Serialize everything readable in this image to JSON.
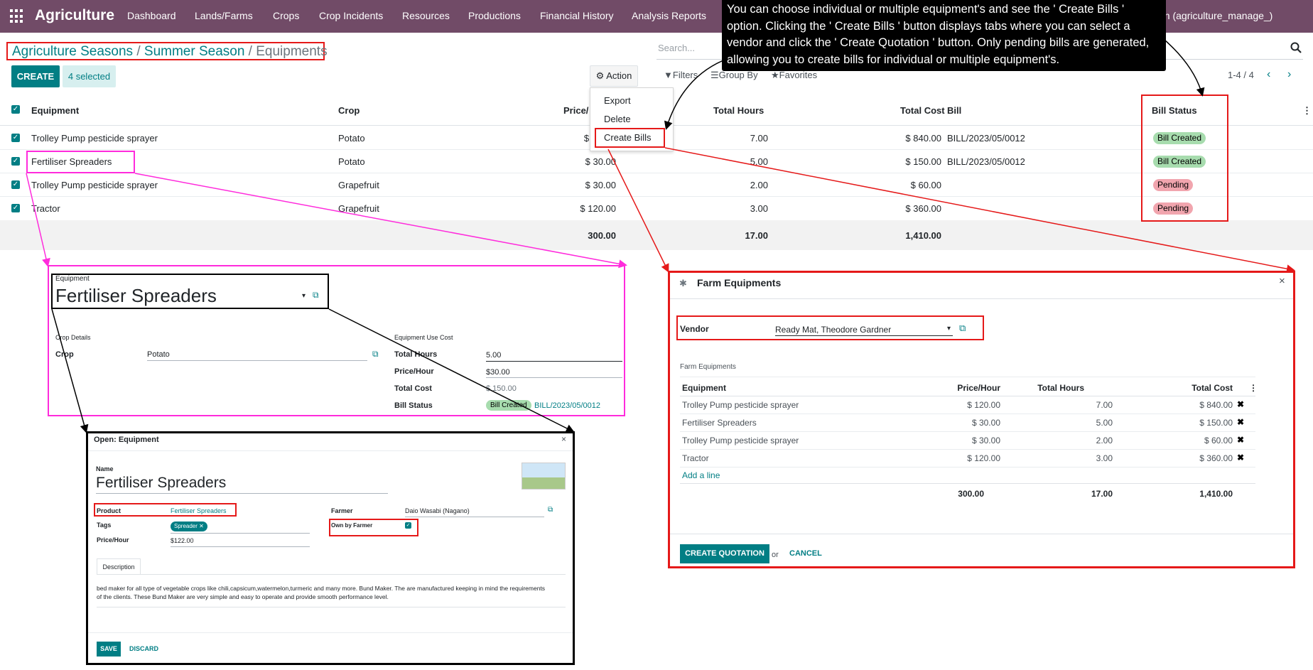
{
  "navbar": {
    "brand": "Agriculture",
    "menu": [
      "Dashboard",
      "Lands/Farms",
      "Crops",
      "Crop Incidents",
      "Resources",
      "Productions",
      "Financial History",
      "Analysis Reports"
    ],
    "user": "nell Admin (agriculture_manage_)"
  },
  "callout": {
    "text": "You can choose individual or multiple equipment's and see the ' Create Bills ' option. Clicking the ' Create Bills ' button displays tabs where you can select a vendor and click the ' Create Quotation ' button. Only pending bills are generated, allowing you to create bills for individual or multiple equipment's."
  },
  "breadcrumb": {
    "seasons": "Agriculture Seasons",
    "season": "Summer Season",
    "current": "Equipments",
    "sep": " / "
  },
  "search": {
    "placeholder": "Search..."
  },
  "toolbar": {
    "create": "CREATE",
    "selected": "4 selected",
    "action": "Action",
    "filters": "Filters",
    "group_by": "Group By",
    "favorites": "Favorites",
    "pager": "1-4 / 4"
  },
  "action_menu": [
    "Export",
    "Delete",
    "Create Bills"
  ],
  "list": {
    "headers": {
      "equipment": "Equipment",
      "crop": "Crop",
      "price": "Price/",
      "hours": "Total Hours",
      "cost": "Total Cost",
      "bill": "Bill",
      "status": "Bill Status"
    },
    "rows": [
      {
        "equipment": "Trolley Pump pesticide sprayer",
        "crop": "Potato",
        "price": "$ 1",
        "hours": "7.00",
        "cost": "$ 840.00",
        "bill": "BILL/2023/05/0012",
        "status": "Bill Created"
      },
      {
        "equipment": "Fertiliser Spreaders",
        "crop": "Potato",
        "price": "$ 30.00",
        "hours": "5.00",
        "cost": "$ 150.00",
        "bill": "BILL/2023/05/0012",
        "status": "Bill Created"
      },
      {
        "equipment": "Trolley Pump pesticide sprayer",
        "crop": "Grapefruit",
        "price": "$ 30.00",
        "hours": "2.00",
        "cost": "$ 60.00",
        "bill": "",
        "status": "Pending"
      },
      {
        "equipment": "Tractor",
        "crop": "Grapefruit",
        "price": "$ 120.00",
        "hours": "3.00",
        "cost": "$ 360.00",
        "bill": "",
        "status": "Pending"
      }
    ],
    "totals": {
      "price": "300.00",
      "hours": "17.00",
      "cost": "1,410.00"
    }
  },
  "equipment_form": {
    "label": "Equipment",
    "name": "Fertiliser Spreaders",
    "crop_section": "Crop Details",
    "crop_label": "Crop",
    "crop_value": "Potato",
    "cost_section": "Equipment Use Cost",
    "hours_label": "Total Hours",
    "hours_value": "5.00",
    "price_label": "Price/Hour",
    "price_value": "$30.00",
    "cost_label": "Total Cost",
    "cost_value": "$ 150.00",
    "status_label": "Bill Status",
    "status_value": "Bill Created",
    "bill_value": "BILL/2023/05/0012"
  },
  "popup": {
    "title": "Open: Equipment",
    "name_label": "Name",
    "name": "Fertiliser Spreaders",
    "product_label": "Product",
    "product_value": "Fertiliser Spreaders",
    "tags_label": "Tags",
    "tag": "Spreader",
    "price_label": "Price/Hour",
    "price_value": "$122.00",
    "farmer_label": "Farmer",
    "farmer_value": "Daio Wasabi (Nagano)",
    "own_label": "Own by Farmer",
    "tab": "Description",
    "description": "bed maker for all type of vegetable crops like chili,capsicum,watermelon,turmeric and many more. Bund Maker. The are manufactured keeping in mind the requirements of the clients. These Bund Maker are very simple and easy to operate and provide smooth performance level.",
    "save": "SAVE",
    "discard": "DISCARD"
  },
  "dialog": {
    "title": "Farm Equipments",
    "vendor_label": "Vendor",
    "vendor_value": "Ready Mat, Theodore Gardner",
    "section": "Farm Equipments",
    "headers": {
      "equipment": "Equipment",
      "price": "Price/Hour",
      "hours": "Total Hours",
      "cost": "Total Cost"
    },
    "rows": [
      {
        "equipment": "Trolley Pump pesticide sprayer",
        "price": "$ 120.00",
        "hours": "7.00",
        "cost": "$ 840.00"
      },
      {
        "equipment": "Fertiliser Spreaders",
        "price": "$ 30.00",
        "hours": "5.00",
        "cost": "$ 150.00"
      },
      {
        "equipment": "Trolley Pump pesticide sprayer",
        "price": "$ 30.00",
        "hours": "2.00",
        "cost": "$ 60.00"
      },
      {
        "equipment": "Tractor",
        "price": "$ 120.00",
        "hours": "3.00",
        "cost": "$ 360.00"
      }
    ],
    "add_line": "Add a line",
    "totals": {
      "price": "300.00",
      "hours": "17.00",
      "cost": "1,410.00"
    },
    "create_quotation": "CREATE QUOTATION",
    "or": "or",
    "cancel": "CANCEL"
  },
  "colors": {
    "navbar": "#714b67",
    "primary": "#017e84",
    "highlight_red": "#e51919",
    "highlight_pink": "#ff2bdc",
    "badge_ok": "#a7dcae",
    "badge_pending": "#f1a5ae"
  }
}
